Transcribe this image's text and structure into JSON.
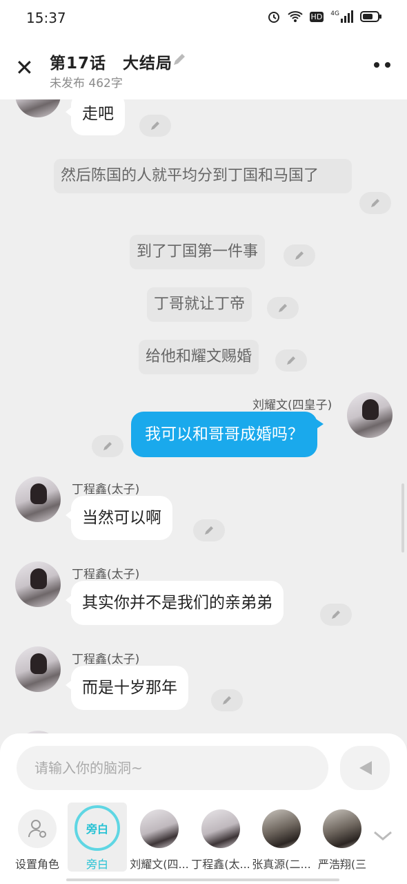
{
  "status_bar": {
    "time": "15:37",
    "hd": "HD",
    "net": "4G"
  },
  "header": {
    "title": "第17话　大结局",
    "subtitle": "未发布 462字"
  },
  "messages": {
    "m1": {
      "text": "走吧"
    },
    "n1": {
      "text": "然后陈国的人就平均分到丁国和马国了"
    },
    "n2": {
      "text": "到了丁国第一件事"
    },
    "n3": {
      "text": "丁哥就让丁帝"
    },
    "n4": {
      "text": "给他和耀文赐婚"
    },
    "m2": {
      "name": "刘耀文(四皇子)",
      "text": "我可以和哥哥成婚吗？"
    },
    "m3": {
      "name": "丁程鑫(太子)",
      "text": "当然可以啊"
    },
    "m4": {
      "name": "丁程鑫(太子)",
      "text": "其实你并不是我们的亲弟弟"
    },
    "m5": {
      "name": "丁程鑫(太子)",
      "text": "而是十岁那年"
    }
  },
  "composer": {
    "placeholder": "请输入你的脑洞~"
  },
  "roles": [
    {
      "label": "设置角色"
    },
    {
      "label": "旁白",
      "badge": "旁白"
    },
    {
      "label": "刘耀文(四..."
    },
    {
      "label": "丁程鑫(太..."
    },
    {
      "label": "张真源(二..."
    },
    {
      "label": "严浩翔(三"
    }
  ],
  "colors": {
    "accent_blue": "#1aa9ec",
    "accent_cyan": "#27c2d4"
  }
}
